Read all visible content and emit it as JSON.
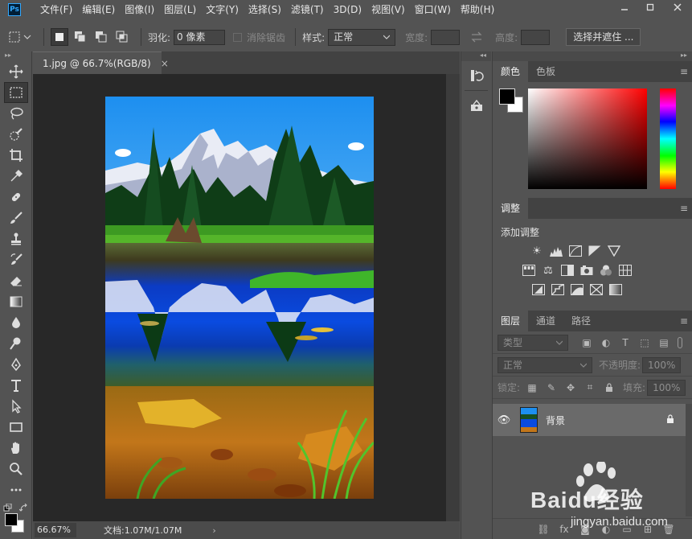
{
  "app": {
    "logo_text": "Ps",
    "menu": [
      "文件(F)",
      "编辑(E)",
      "图像(I)",
      "图层(L)",
      "文字(Y)",
      "选择(S)",
      "滤镜(T)",
      "3D(D)",
      "视图(V)",
      "窗口(W)",
      "帮助(H)"
    ]
  },
  "options_bar": {
    "feather_label": "羽化:",
    "feather_value": "0 像素",
    "antialias_label": "消除锯齿",
    "style_label": "样式:",
    "style_value": "正常",
    "width_label": "宽度:",
    "height_label": "高度:",
    "select_mask_button": "选择并遮住 ..."
  },
  "document": {
    "tab_title": "1.jpg @ 66.7%(RGB/8)",
    "tab_close": "×",
    "zoom": "66.67%",
    "doc_info": "文档:1.07M/1.07M",
    "status_arrow": "›"
  },
  "panels": {
    "color": {
      "tabs": [
        "颜色",
        "色板"
      ],
      "foreground": "#000000",
      "background": "#ffffff"
    },
    "adjustments": {
      "tab": "调整",
      "title": "添加调整"
    },
    "layers": {
      "tabs": [
        "图层",
        "通道",
        "路径"
      ],
      "filter_kind": "类型",
      "blend_mode": "正常",
      "opacity_label": "不透明度:",
      "opacity_value": "100%",
      "lock_label": "锁定:",
      "fill_label": "填充:",
      "fill_value": "100%",
      "layer_name": "背景"
    }
  },
  "watermark": {
    "brand": "Baidu经验",
    "url": "jingyan.baidu.com"
  },
  "colors": {
    "ui_bg": "#535353",
    "canvas_bg": "#282828",
    "ps_blue": "#31a8ff",
    "selected_layer": "#6a6a6a"
  }
}
